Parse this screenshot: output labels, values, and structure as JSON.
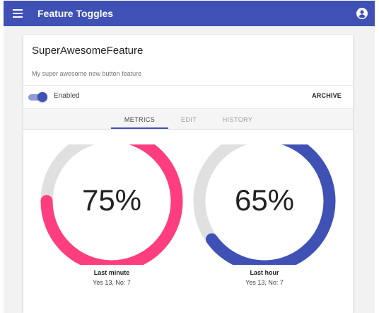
{
  "app": {
    "title": "Feature Toggles",
    "menu_icon": "hamburger-menu-icon",
    "account_icon": "account-circle-icon",
    "primary_color": "#3f51b5"
  },
  "feature": {
    "name": "SuperAwesomeFeature",
    "description": "My super awesome new button feature",
    "enabled": true,
    "enabled_label": "Enabled",
    "archive_label": "ARCHIVE"
  },
  "tabs": [
    {
      "label": "METRICS",
      "active": true
    },
    {
      "label": "EDIT",
      "active": false
    },
    {
      "label": "HISTORY",
      "active": false
    }
  ],
  "metrics": [
    {
      "percent_label": "75%",
      "percent": 75,
      "caption": "Last minute",
      "counts": "Yes 13, No: 7",
      "color": "#ff3d7f"
    },
    {
      "percent_label": "65%",
      "percent": 65,
      "caption": "Last hour",
      "counts": "Yes 13, No: 7",
      "color": "#3f51b5"
    }
  ],
  "colors": {
    "track": "#e0e0e0"
  }
}
